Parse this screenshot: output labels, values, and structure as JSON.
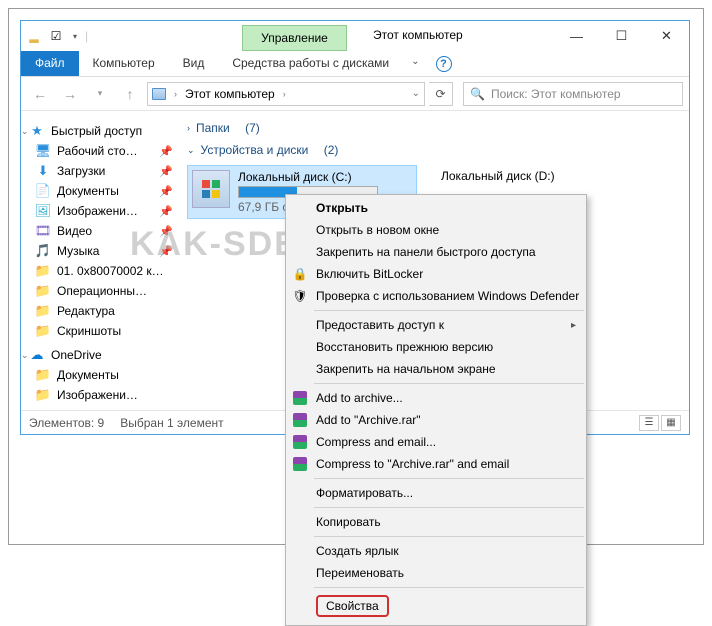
{
  "title": {
    "manage": "Управление",
    "label": "Этот компьютер"
  },
  "ribbon": {
    "file": "Файл",
    "computer": "Компьютер",
    "view": "Вид",
    "disktools": "Средства работы с дисками"
  },
  "addr": {
    "root": "Этот компьютер"
  },
  "search": {
    "placeholder": "Поиск: Этот компьютер"
  },
  "sidebar": {
    "quick": "Быстрый доступ",
    "items": [
      {
        "label": "Рабочий сто…",
        "pin": true
      },
      {
        "label": "Загрузки",
        "pin": true
      },
      {
        "label": "Документы",
        "pin": true
      },
      {
        "label": "Изображени…",
        "pin": true
      },
      {
        "label": "Видео",
        "pin": true
      },
      {
        "label": "Музыка",
        "pin": true
      },
      {
        "label": "01. 0x80070002 к…",
        "pin": false
      },
      {
        "label": "Операционны…",
        "pin": false
      },
      {
        "label": "Редактура",
        "pin": false
      },
      {
        "label": "Скриншоты",
        "pin": false
      }
    ],
    "onedrive": "OneDrive",
    "od_items": [
      {
        "label": "Документы"
      },
      {
        "label": "Изображени…"
      }
    ]
  },
  "content": {
    "folders": {
      "label": "Папки",
      "count": "(7)"
    },
    "devices": {
      "label": "Устройства и диски",
      "count": "(2)"
    },
    "drives": [
      {
        "name": "Локальный диск (C:)",
        "free": "67,9 ГБ своб…",
        "fill": 42
      },
      {
        "name": "Локальный диск (D:)"
      }
    ]
  },
  "status": {
    "items": "Элементов: 9",
    "selected": "Выбран 1 элемент"
  },
  "ctx": [
    {
      "t": "item",
      "label": "Открыть",
      "bold": true
    },
    {
      "t": "item",
      "label": "Открыть в новом окне"
    },
    {
      "t": "item",
      "label": "Закрепить на панели быстрого доступа"
    },
    {
      "t": "item",
      "label": "Включить BitLocker",
      "icon": "lock"
    },
    {
      "t": "item",
      "label": "Проверка с использованием Windows Defender",
      "icon": "shield"
    },
    {
      "t": "sep"
    },
    {
      "t": "item",
      "label": "Предоставить доступ к",
      "sub": true
    },
    {
      "t": "item",
      "label": "Восстановить прежнюю версию"
    },
    {
      "t": "item",
      "label": "Закрепить на начальном экране"
    },
    {
      "t": "sep"
    },
    {
      "t": "item",
      "label": "Add to archive...",
      "icon": "rar"
    },
    {
      "t": "item",
      "label": "Add to \"Archive.rar\"",
      "icon": "rar"
    },
    {
      "t": "item",
      "label": "Compress and email...",
      "icon": "rar"
    },
    {
      "t": "item",
      "label": "Compress to \"Archive.rar\" and email",
      "icon": "rar"
    },
    {
      "t": "sep"
    },
    {
      "t": "item",
      "label": "Форматировать..."
    },
    {
      "t": "sep"
    },
    {
      "t": "item",
      "label": "Копировать"
    },
    {
      "t": "sep"
    },
    {
      "t": "item",
      "label": "Создать ярлык"
    },
    {
      "t": "item",
      "label": "Переименовать"
    },
    {
      "t": "sep"
    },
    {
      "t": "hl",
      "label": "Свойства"
    }
  ],
  "watermark": "KAK-SDELAT.ORG"
}
